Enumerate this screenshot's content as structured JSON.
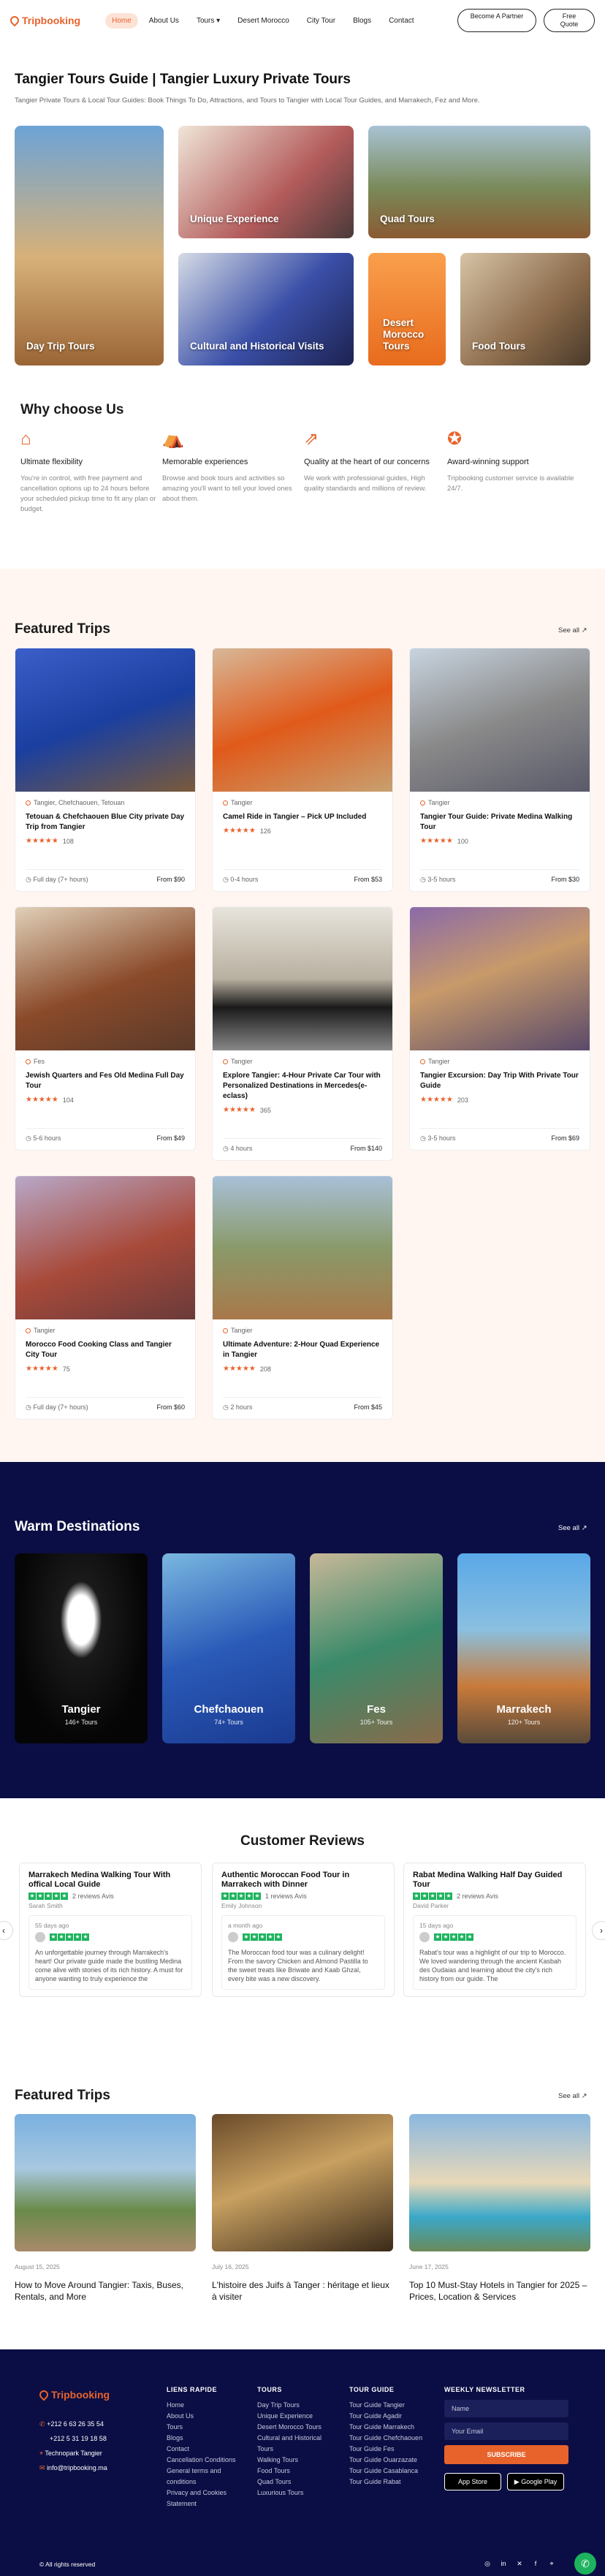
{
  "header": {
    "brand": "Tripbooking",
    "nav": [
      "Home",
      "About Us",
      "Tours",
      "Desert Morocco",
      "City Tour",
      "Blogs",
      "Contact"
    ],
    "tours_caret": "▾",
    "partner": "Become A Partner",
    "quote": "Free Quote"
  },
  "hero": {
    "title": "Tangier Tours Guide | Tangier Luxury Private Tours",
    "subtitle": "Tangier Private Tours & Local Tour Guides: Book Things To Do, Attractions, and Tours to Tangier with Local Tour Guides, and Marrakech, Fez and More.",
    "tiles": [
      "Day Trip Tours",
      "Unique Experience",
      "Quad Tours",
      "Cultural and Historical Visits",
      "Desert Morocco Tours",
      "Food Tours"
    ]
  },
  "why": {
    "title": "Why choose Us",
    "items": [
      {
        "title": "Ultimate flexibility",
        "text": "You're in control, with free payment and cancellation options up to 24 hours before your scheduled pickup time to fit any plan or budget."
      },
      {
        "title": "Memorable experiences",
        "text": "Browse and book tours and activities so amazing you'll want to tell your loved ones about them."
      },
      {
        "title": "Quality at the heart of our concerns",
        "text": "We work with professional guides, High quality standards and millions of review."
      },
      {
        "title": "Award-winning support",
        "text": "Tripbooking customer service is available 24/7."
      }
    ]
  },
  "featured": {
    "title": "Featured Trips",
    "see_all": "See all ↗",
    "cards": [
      {
        "loc": "Tangier, Chefchaouen, Tetouan",
        "title": "Tetouan & Chefchaouen Blue City private Day Trip from Tangier",
        "stars": "★★★★★",
        "reviews": "108",
        "dur": "Full day (7+ hours)",
        "price": "From $90"
      },
      {
        "loc": "Tangier",
        "title": "Camel Ride in Tangier – Pick UP Included",
        "stars": "★★★★★",
        "reviews": "126",
        "dur": "0-4 hours",
        "price": "From $53"
      },
      {
        "loc": "Tangier",
        "title": "Tangier Tour Guide: Private Medina Walking Tour",
        "stars": "★★★★★",
        "reviews": "100",
        "dur": "3-5 hours",
        "price": "From $30"
      },
      {
        "loc": "Fes",
        "title": "Jewish Quarters and Fes Old Medina Full Day Tour",
        "stars": "★★★★★",
        "reviews": "104",
        "dur": "5-6 hours",
        "price": "From $49"
      },
      {
        "loc": "Tangier",
        "title": "Explore Tangier: 4-Hour Private Car Tour with Personalized Destinations in Mercedes(e-eclass)",
        "stars": "★★★★★",
        "reviews": "365",
        "dur": "4 hours",
        "price": "From $140"
      },
      {
        "loc": "Tangier",
        "title": "Tangier Excursion: Day Trip With Private Tour Guide",
        "stars": "★★★★★",
        "reviews": "203",
        "dur": "3-5 hours",
        "price": "From $69"
      },
      {
        "loc": "Tangier",
        "title": "Morocco Food Cooking Class and Tangier City Tour",
        "stars": "★★★★★",
        "reviews": "75",
        "dur": "Full day (7+ hours)",
        "price": "From $60"
      },
      {
        "loc": "Tangier",
        "title": "Ultimate Adventure: 2-Hour Quad Experience in Tangier",
        "stars": "★★★★★",
        "reviews": "208",
        "dur": "2 hours",
        "price": "From $45"
      }
    ]
  },
  "destinations": {
    "title": "Warm Destinations",
    "see_all": "See all ↗",
    "items": [
      {
        "name": "Tangier",
        "tours": "146+ Tours"
      },
      {
        "name": "Chefchaouen",
        "tours": "74+ Tours"
      },
      {
        "name": "Fes",
        "tours": "105+ Tours"
      },
      {
        "name": "Marrakech",
        "tours": "120+ Tours"
      }
    ]
  },
  "reviews": {
    "title": "Customer Reviews",
    "items": [
      {
        "title": "Marrakech Medina Walking Tour With offical Local Guide",
        "count": "2 reviews Avis",
        "user": "Sarah Smith",
        "date": "55 days ago",
        "text": "An unforgettable journey through Marrakech's heart! Our private guide made the bustling Medina come alive with stories of its rich history. A must for anyone wanting to truly experience the"
      },
      {
        "title": "Authentic Moroccan Food Tour in Marrakech with Dinner",
        "count": "1 reviews Avis",
        "user": "Emily Johnson",
        "date": "a month ago",
        "text": "The Moroccan food tour was a culinary delight! From the savory Chicken and Almond Pastilla to the sweet treats like Briwate and Kaab Ghzal, every bite was a new discovery."
      },
      {
        "title": "Rabat Medina Walking Half Day Guided Tour",
        "count": "2 reviews Avis",
        "user": "David Parker",
        "date": "15 days ago",
        "text": "Rabat's tour was a highlight of our trip to Morocco. We loved wandering through the ancient Kasbah des Oudaias and learning about the city's rich history from our guide. The"
      }
    ]
  },
  "blog": {
    "title": "Featured Trips",
    "see_all": "See all ↗",
    "items": [
      {
        "date": "August 15, 2025",
        "title": "How to Move Around Tangier: Taxis, Buses, Rentals, and More"
      },
      {
        "date": "July 16, 2025",
        "title": "L'histoire des Juifs à Tanger : héritage et lieux à visiter"
      },
      {
        "date": "June 17, 2025",
        "title": "Top 10 Must-Stay Hotels in Tangier for 2025 – Prices, Location & Services"
      }
    ]
  },
  "footer": {
    "brand": "Tripbooking",
    "phone1": "+212 6 63 26 35 54",
    "phone2": "+212 5 31 19 18 58",
    "address": "Technopark Tangier",
    "email": "info@tripbooking.ma",
    "cols": [
      {
        "title": "LIENS RAPIDE",
        "links": [
          "Home",
          "About Us",
          "Tours",
          "Blogs",
          "Contact",
          "Cancellation Conditions",
          "General terms and conditions",
          "Privacy and Cookies Statement"
        ]
      },
      {
        "title": "TOURS",
        "links": [
          "Day Trip Tours",
          "Unique Experience",
          "Desert Morocco Tours",
          "Cultural and Historical Tours",
          "Walking Tours",
          "Food Tours",
          "Quad Tours",
          "Luxurious Tours"
        ]
      },
      {
        "title": "TOUR GUIDE",
        "links": [
          "Tour Guide Tangier",
          "Tour Guide Agadir",
          "Tour Guide Marrakech",
          "Tour Guide Chefchaouen",
          "Tour Guide Fes",
          "Tour Guide Ouarzazate",
          "Tour Guide Casablanca",
          "Tour Guide Rabat"
        ]
      }
    ],
    "newsletter": "WEEKLY NEWSLETTER",
    "name_ph": "Name",
    "email_ph": "Your Email",
    "subscribe": "SUBSCRIBE",
    "appstore": "App Store",
    "gplay": "Google Play",
    "copy": "© All rights reserved"
  }
}
